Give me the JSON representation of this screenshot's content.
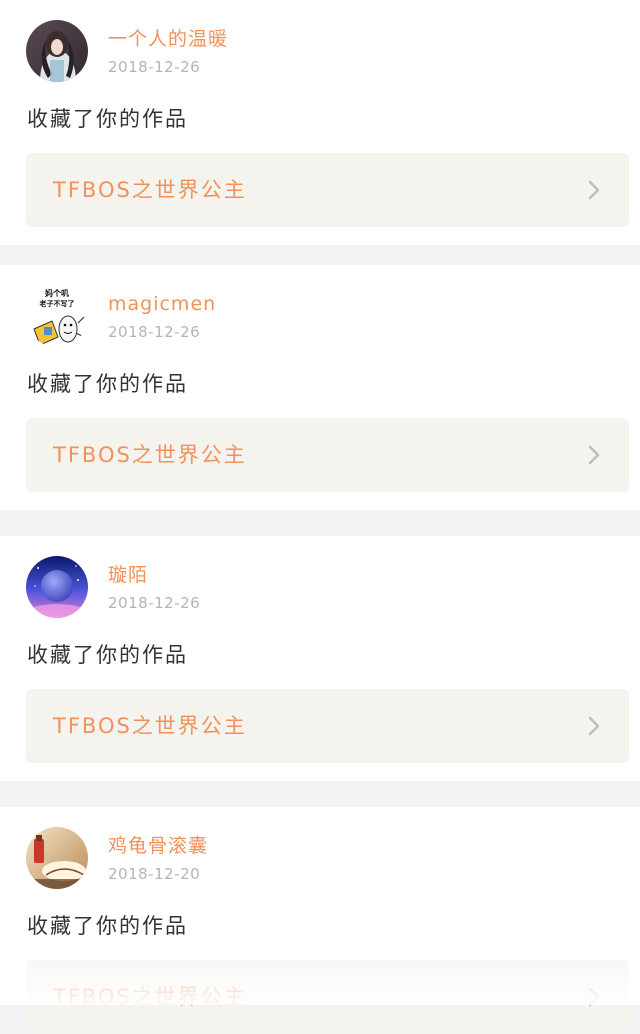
{
  "items": [
    {
      "username": "一个人的温暖",
      "date": "2018-12-26",
      "action": "收藏了你的作品",
      "work_title": "TFBOS之世界公主",
      "avatar_icon": "girl-photo-avatar"
    },
    {
      "username": "magicmen",
      "date": "2018-12-26",
      "action": "收藏了你的作品",
      "work_title": "TFBOS之世界公主",
      "avatar_icon": "meme-sticker-avatar",
      "avatar_caption_line1": "妈个叽",
      "avatar_caption_line2": "老子不写了"
    },
    {
      "username": "璇陌",
      "date": "2018-12-26",
      "action": "收藏了你的作品",
      "work_title": "TFBOS之世界公主",
      "avatar_icon": "galaxy-planet-avatar"
    },
    {
      "username": "鸡龟骨滚囊",
      "date": "2018-12-20",
      "action": "收藏了你的作品",
      "work_title": "TFBOS之世界公主",
      "avatar_icon": "warm-photo-avatar"
    }
  ],
  "colors": {
    "accent": "#f2915a",
    "date": "#b4b4b4",
    "text": "#333333",
    "work_bg": "#f4f3ee",
    "divider": "#f3f3f3"
  }
}
